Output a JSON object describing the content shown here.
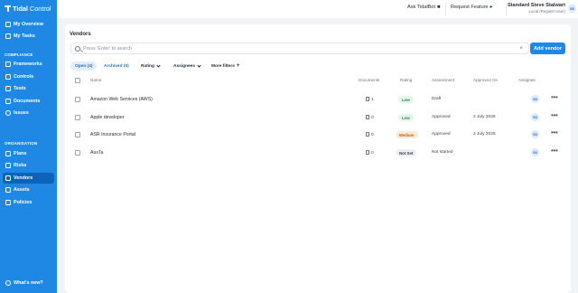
{
  "brand": {
    "name_bold": "Tidal",
    "name_light": "Control"
  },
  "sidebar": {
    "top_items": [
      {
        "label": "My Overview"
      },
      {
        "label": "My Tasks"
      }
    ],
    "compliance_label": "COMPLIANCE",
    "compliance_items": [
      {
        "label": "Frameworks"
      },
      {
        "label": "Controls"
      },
      {
        "label": "Tests"
      },
      {
        "label": "Documents"
      },
      {
        "label": "Issues"
      }
    ],
    "organisation_label": "ORGANISATION",
    "organisation_items": [
      {
        "label": "Plans"
      },
      {
        "label": "Risks"
      },
      {
        "label": "Vendors",
        "active": true
      },
      {
        "label": "Assets"
      },
      {
        "label": "Policies"
      }
    ],
    "whats_new": "What's new?"
  },
  "topbar": {
    "ask_bot": "Ask TidalBot",
    "request_feature": "Request Feature",
    "user_name": "Standard Steve Stalwart",
    "user_role": "Local (Regular User)",
    "user_initials": "SS"
  },
  "page": {
    "title": "Vendors",
    "search_placeholder": "Press 'Enter' to search",
    "add_button": "Add vendor",
    "tabs": [
      {
        "label": "Open (4)",
        "active": true
      },
      {
        "label": "Archived (0)",
        "active": false
      }
    ],
    "filters": [
      "Rating",
      "Assignees",
      "More filters"
    ]
  },
  "table": {
    "headers": [
      "Name",
      "Documents",
      "Rating",
      "Assessment",
      "Approved On",
      "Assignee"
    ],
    "rows": [
      {
        "name": "Amazon Web Services (AWS)",
        "documents": "1",
        "rating": "Low",
        "assessment": "Draft",
        "approved_on": "",
        "assignee": "SS"
      },
      {
        "name": "Apple developer",
        "documents": "0",
        "rating": "Low",
        "assessment": "Approved",
        "approved_on": "2 July 2025",
        "assignee": "SS"
      },
      {
        "name": "ASR Insurance Portal",
        "documents": "0",
        "rating": "Medium",
        "assessment": "Approved",
        "approved_on": "2 July 2025",
        "assignee": "SS"
      },
      {
        "name": "AusTa",
        "documents": "0",
        "rating": "Not Set",
        "assessment": "Not started",
        "approved_on": "",
        "assignee": "SS"
      }
    ]
  },
  "colors": {
    "sidebar_bg": "#1f88e5",
    "active_nav": "#0d63b8",
    "accent": "#1f88e5",
    "rating_low_bg": "#e3f7ea",
    "rating_low_fg": "#1f8a4c",
    "rating_medium_bg": "#fdebd9",
    "rating_medium_fg": "#c2620f",
    "rating_notset_bg": "#eceef1",
    "rating_notset_fg": "#374151"
  }
}
